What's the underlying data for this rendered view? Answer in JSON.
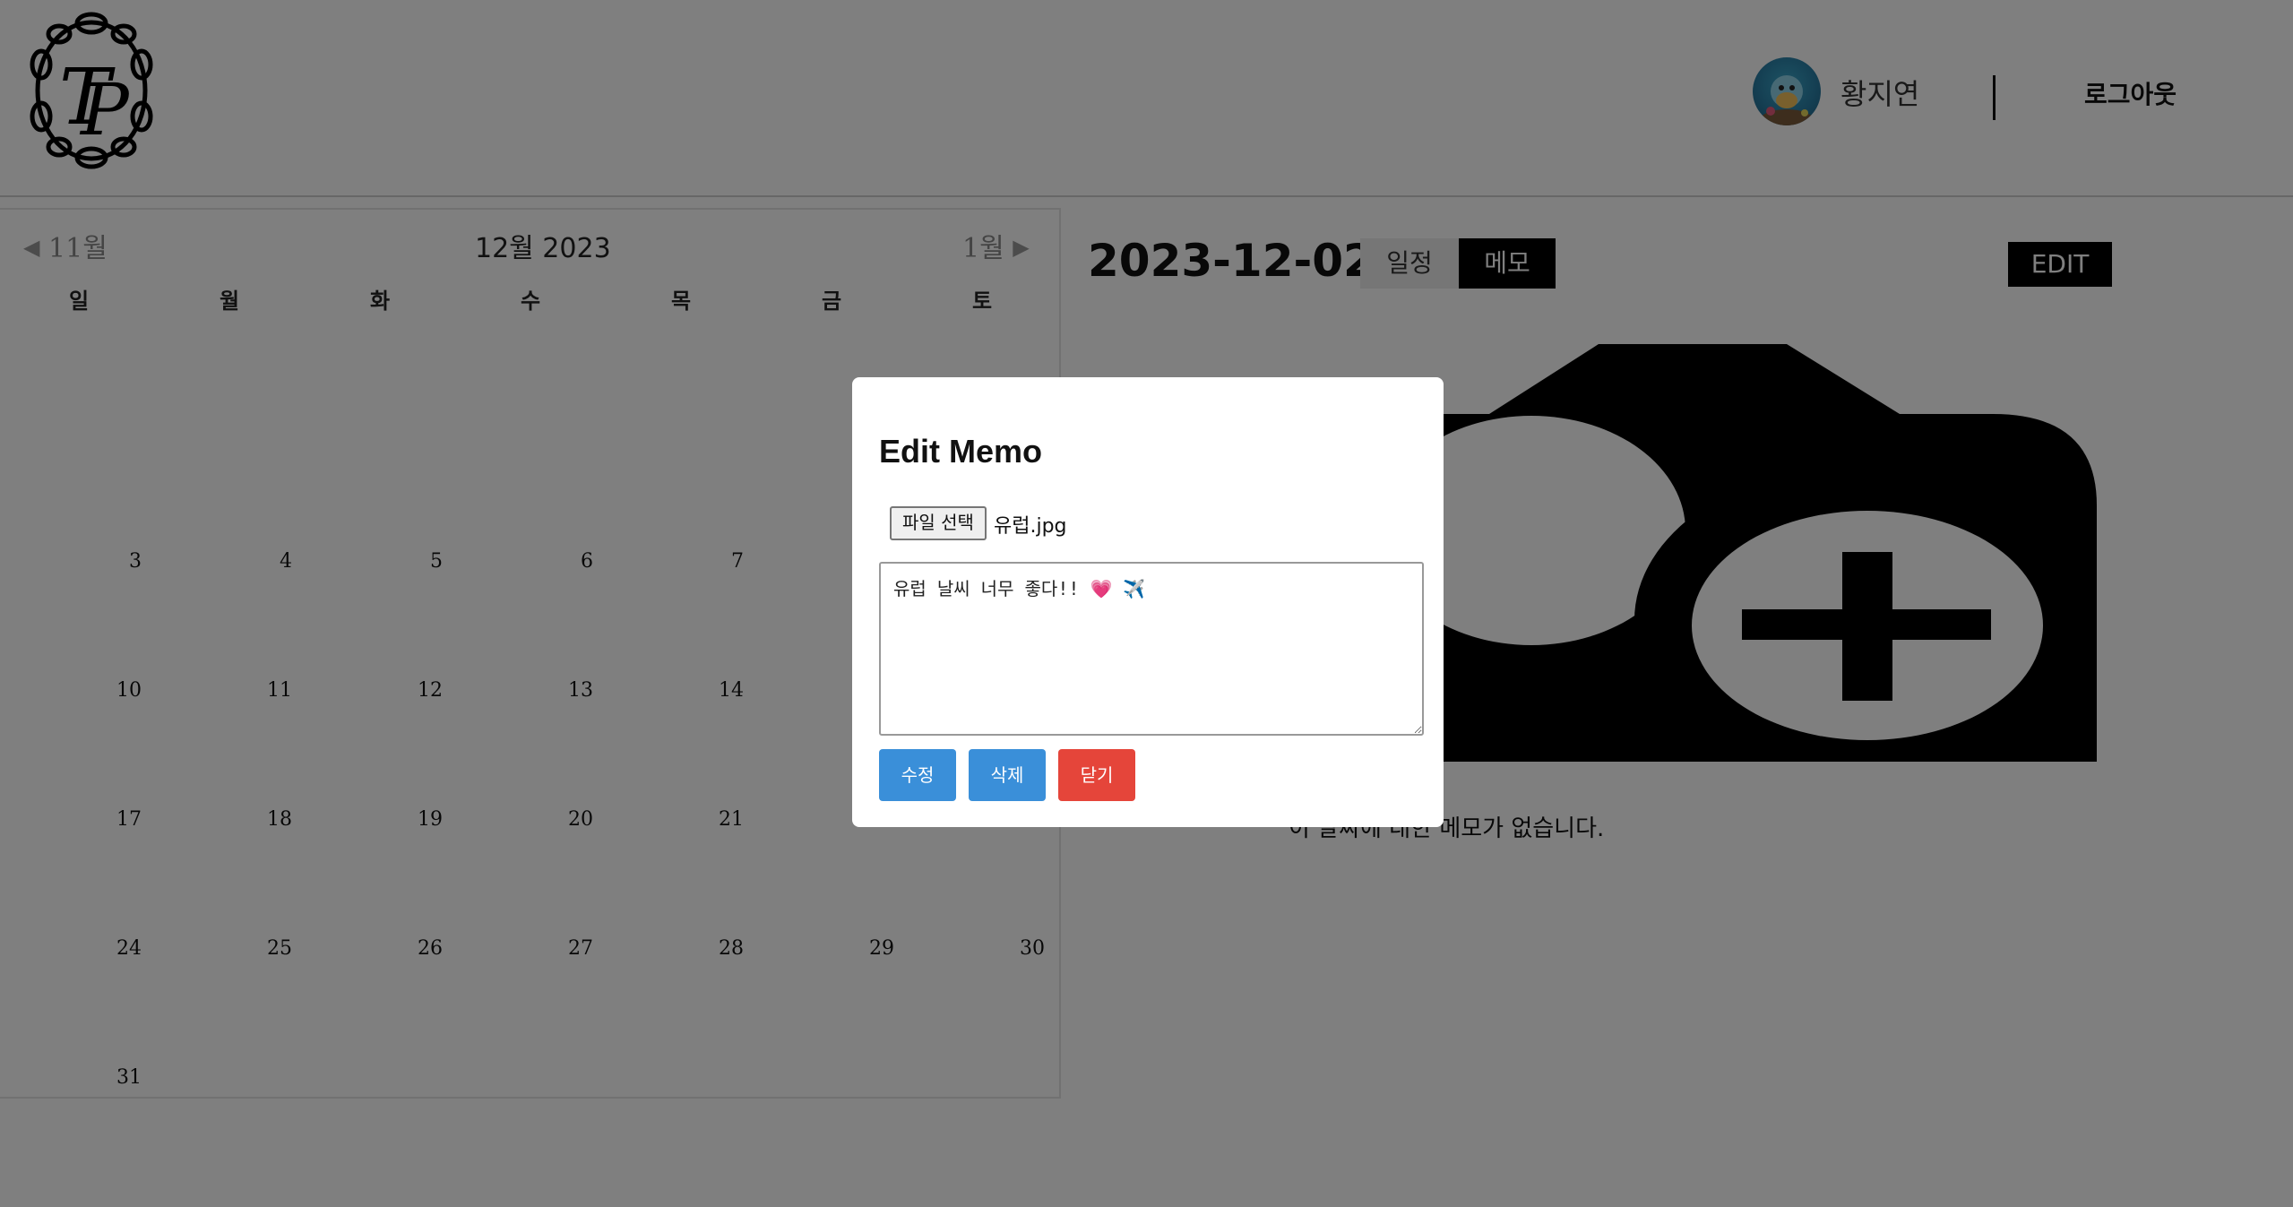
{
  "header": {
    "user_name": "황지연",
    "logout_label": "로그아웃"
  },
  "calendar": {
    "prev_label": "11월",
    "next_label": "1월",
    "title": "12월 2023",
    "weekdays": [
      "일",
      "월",
      "화",
      "수",
      "목",
      "금",
      "토"
    ],
    "rows": [
      [
        "",
        "",
        "",
        "",
        "",
        "",
        ""
      ],
      [
        "3",
        "4",
        "5",
        "6",
        "7",
        "",
        ""
      ],
      [
        "10",
        "11",
        "12",
        "13",
        "14",
        "",
        ""
      ],
      [
        "17",
        "18",
        "19",
        "20",
        "21",
        "",
        ""
      ],
      [
        "24",
        "25",
        "26",
        "27",
        "28",
        "29",
        "30"
      ],
      [
        "31",
        "",
        "",
        "",
        "",
        "",
        ""
      ]
    ]
  },
  "detail": {
    "date": "2023-12-02",
    "tabs": [
      {
        "label": "일정",
        "active": false
      },
      {
        "label": "메모",
        "active": true
      }
    ],
    "edit_label": "EDIT",
    "empty_text": "이 날짜에 대한 메모가 없습니다."
  },
  "modal": {
    "title": "Edit Memo",
    "file_button_label": "파일 선택",
    "file_name": "유럽.jpg",
    "memo_text": "유럽 날씨 너무 좋다!! 💗 ✈️",
    "buttons": {
      "edit": "수정",
      "delete": "삭제",
      "close": "닫기"
    }
  },
  "colors": {
    "primary_button": "#3a8fd9",
    "danger_button": "#e5453a",
    "active_tab": "#000000"
  }
}
